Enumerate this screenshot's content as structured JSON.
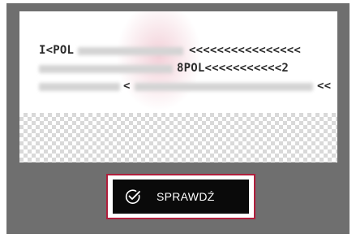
{
  "mrz": {
    "line1_start": "I<POL",
    "line1_end": "<<<<<<<<<<<<<<<<",
    "line2_mid": "8POL<<<<<<<<<<<2",
    "line3_mid": "<",
    "line3_end": "<<"
  },
  "button": {
    "label": "SPRAWDŹ",
    "icon": "check-circle-icon",
    "accent_border": "#b01e3c"
  }
}
